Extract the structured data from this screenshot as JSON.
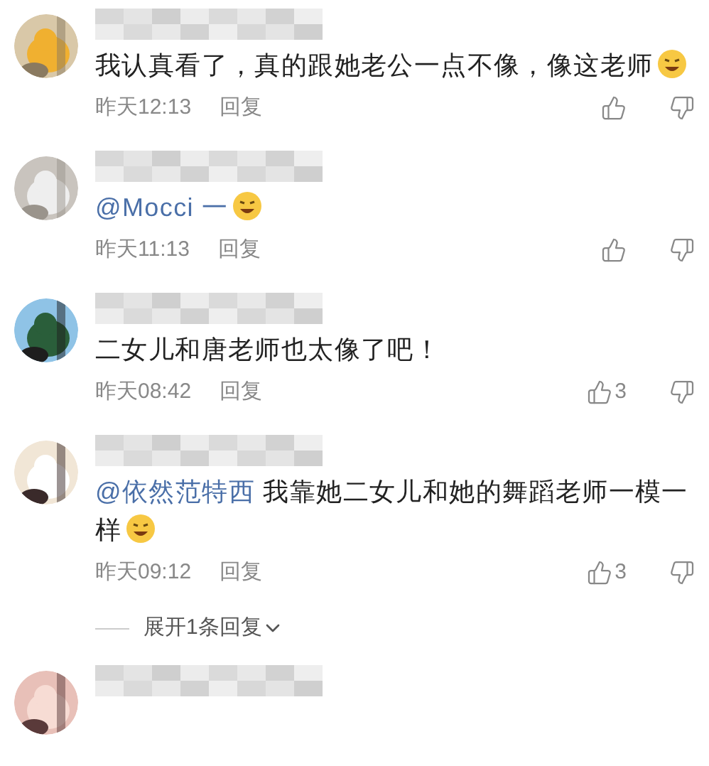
{
  "comments": [
    {
      "segments": [
        {
          "kind": "text",
          "text": "我认真看了，真的跟她老公一点不像，像这老师"
        },
        {
          "kind": "emoji"
        }
      ],
      "time": "昨天12:13",
      "reply": "回复"
    },
    {
      "segments": [
        {
          "kind": "mention",
          "text": "@Mocci 一"
        },
        {
          "kind": "emoji"
        }
      ],
      "time": "昨天11:13",
      "reply": "回复"
    },
    {
      "segments": [
        {
          "kind": "text",
          "text": "二女儿和唐老师也太像了吧！"
        }
      ],
      "time": "昨天08:42",
      "reply": "回复",
      "likes": "3"
    },
    {
      "segments": [
        {
          "kind": "mention",
          "text": "@依然范特西"
        },
        {
          "kind": "text",
          "text": " 我靠她二女儿和她的舞蹈老师一模一样"
        },
        {
          "kind": "emoji"
        }
      ],
      "time": "昨天09:12",
      "reply": "回复",
      "likes": "3",
      "expand": "展开1条回复"
    }
  ]
}
